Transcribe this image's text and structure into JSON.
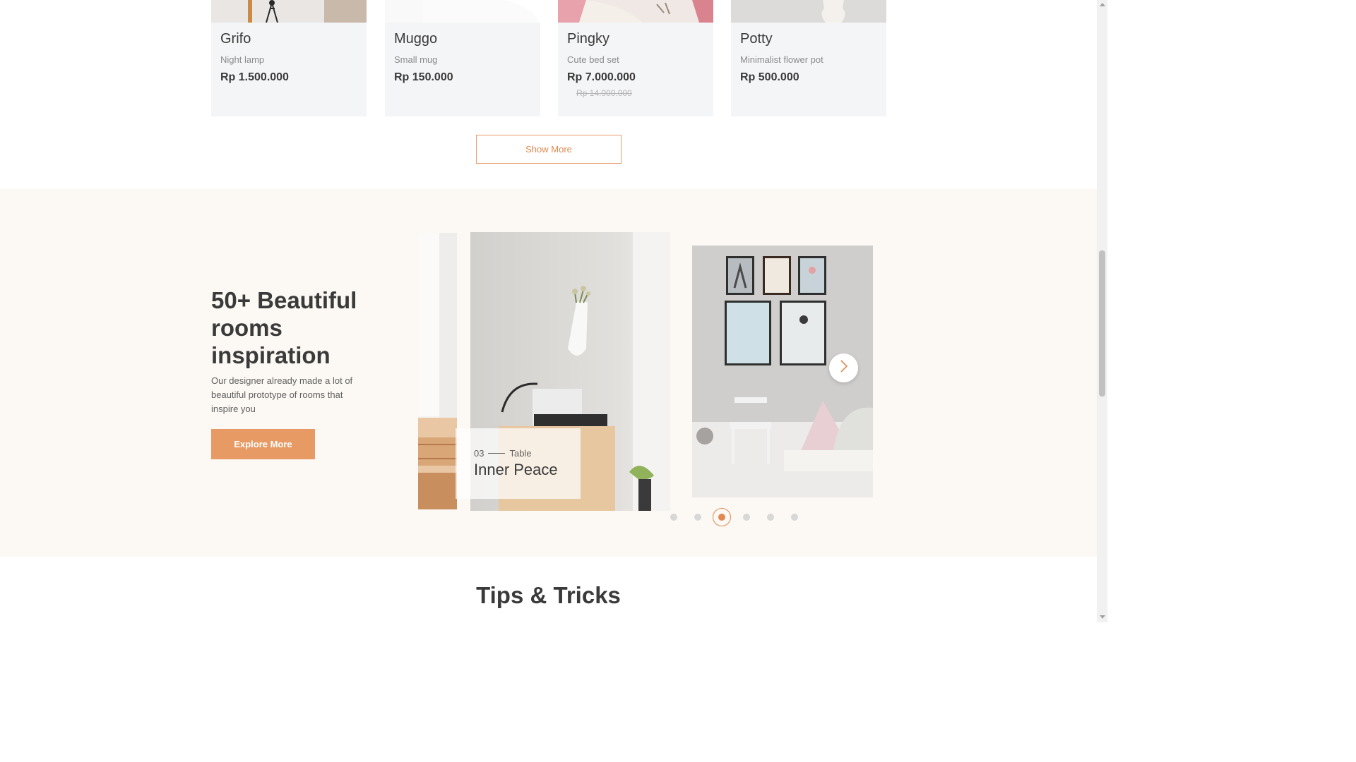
{
  "products": {
    "items": [
      {
        "name": "Grifo",
        "desc": "Night lamp",
        "price": "Rp 1.500.000",
        "old_price": ""
      },
      {
        "name": "Muggo",
        "desc": "Small mug",
        "price": "Rp 150.000",
        "old_price": ""
      },
      {
        "name": "Pingky",
        "desc": "Cute bed set",
        "price": "Rp 7.000.000",
        "old_price": "Rp 14.000.000"
      },
      {
        "name": "Potty",
        "desc": "Minimalist flower pot",
        "price": "Rp 500.000",
        "old_price": ""
      }
    ],
    "show_more_label": "Show More"
  },
  "inspiration": {
    "title": "50+ Beautiful rooms inspiration",
    "subtitle": "Our designer already made a lot of beautiful prototype of rooms that inspire you",
    "explore_label": "Explore More",
    "caption": {
      "number": "03",
      "category": "Table",
      "title": "Inner Peace"
    },
    "next_icon": "chevron-right-icon",
    "dots_total": 6,
    "dots_active": 3
  },
  "tips": {
    "title": "Tips & Tricks"
  },
  "colors": {
    "accent": "#e89a64",
    "accent_text": "#e08a52",
    "section_bg": "#fcf8f3",
    "card_bg": "#f4f5f7",
    "text_dark": "#3a3a3a",
    "text_muted": "#8a8a8a"
  }
}
